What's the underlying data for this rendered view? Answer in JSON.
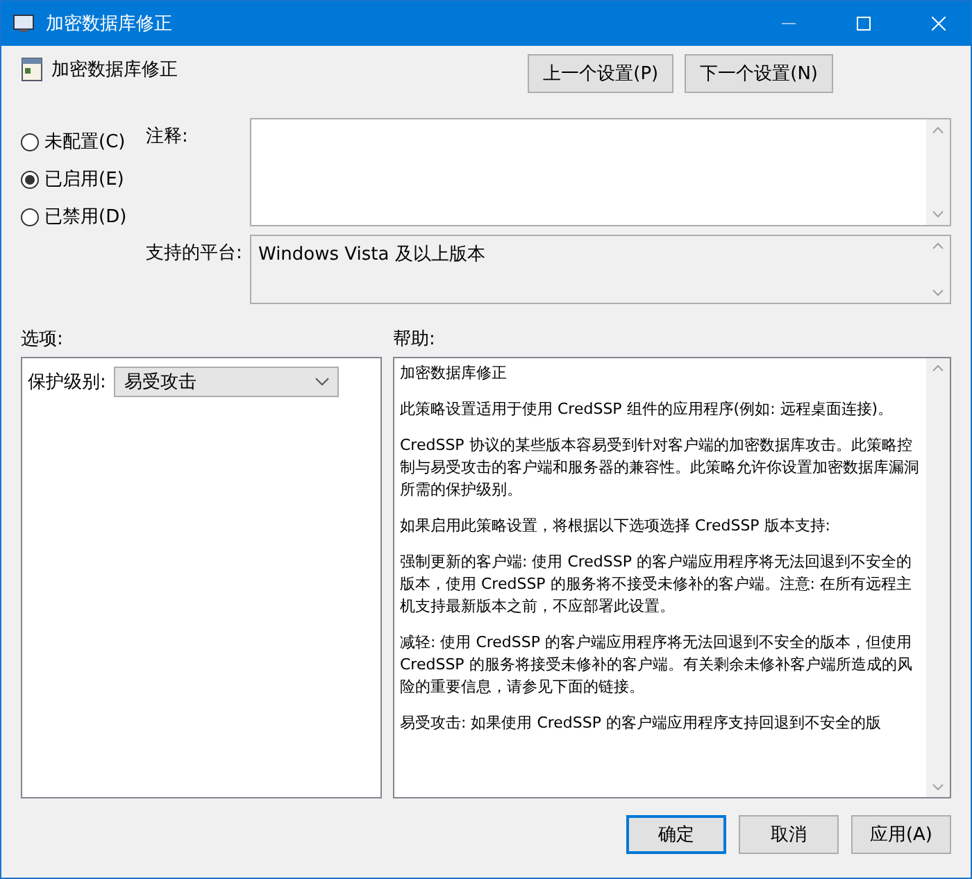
{
  "window": {
    "title": "加密数据库修正"
  },
  "setting_title": "加密数据库修正",
  "nav_buttons": [
    "上一个设置(P)",
    "下一个设置(N)"
  ],
  "radios": [
    {
      "label": "未配置(C)",
      "selected": false
    },
    {
      "label": "已启用(E)",
      "selected": true
    },
    {
      "label": "已禁用(D)",
      "selected": false
    }
  ],
  "comment": {
    "label": "注释:"
  },
  "platform": {
    "label": "支持的平台:",
    "value": "Windows Vista 及以上版本"
  },
  "options": {
    "label": "选项:",
    "field_label": "保护级别:",
    "value": "易受攻击"
  },
  "help": {
    "label": "帮助:",
    "paragraphs": [
      "加密数据库修正",
      "此策略设置适用于使用 CredSSP 组件的应用程序(例如: 远程桌面连接)。",
      "CredSSP 协议的某些版本容易受到针对客户端的加密数据库攻击。此策略控制与易受攻击的客户端和服务器的兼容性。此策略允许你设置加密数据库漏洞所需的保护级别。",
      "如果启用此策略设置，将根据以下选项选择 CredSSP 版本支持:",
      "强制更新的客户端: 使用 CredSSP 的客户端应用程序将无法回退到不安全的版本，使用 CredSSP 的服务将不接受未修补的客户端。注意: 在所有远程主机支持最新版本之前，不应部署此设置。",
      "减轻: 使用 CredSSP 的客户端应用程序将无法回退到不安全的版本，但使用 CredSSP 的服务将接受未修补的客户端。有关剩余未修补客户端所造成的风险的重要信息，请参见下面的链接。",
      "易受攻击: 如果使用 CredSSP 的客户端应用程序支持回退到不安全的版"
    ]
  },
  "buttons": [
    {
      "label": "确定",
      "selected": true
    },
    {
      "label": "取消",
      "selected": false
    },
    {
      "label": "应用(A)",
      "selected": false
    }
  ]
}
